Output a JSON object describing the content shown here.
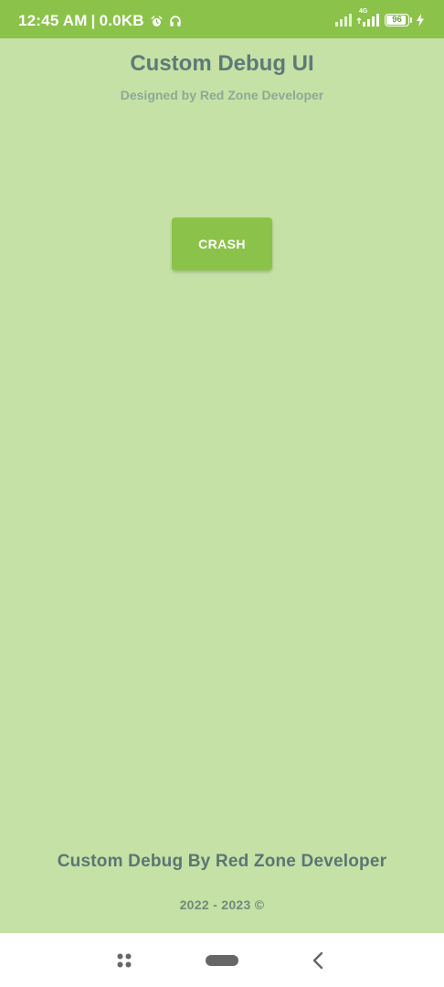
{
  "status_bar": {
    "time": "12:45 AM",
    "separator": "|",
    "data_usage": "0.0KB",
    "icons_left": [
      "alarm-icon",
      "headphones-icon"
    ],
    "icons_right": [
      "signal-icon",
      "signal-4g-icon",
      "battery-icon",
      "charging-icon"
    ],
    "network_label": "4G",
    "battery_level": "96",
    "battery_fraction": 0.96
  },
  "app": {
    "title": "Custom Debug UI",
    "subtitle": "Designed by Red Zone Developer",
    "crash_button_label": "CRASH"
  },
  "footer": {
    "title": "Custom Debug By Red Zone Developer",
    "copyright": "2022 - 2023 ©"
  },
  "nav_bar": {
    "buttons": [
      "recent-apps-icon",
      "home-icon",
      "back-icon"
    ]
  },
  "colors": {
    "status_bar": "#8bc34a",
    "background": "#c5e1a5",
    "button": "#8bc34a",
    "title_text": "#5d7a78",
    "nav_bar": "#ffffff"
  }
}
